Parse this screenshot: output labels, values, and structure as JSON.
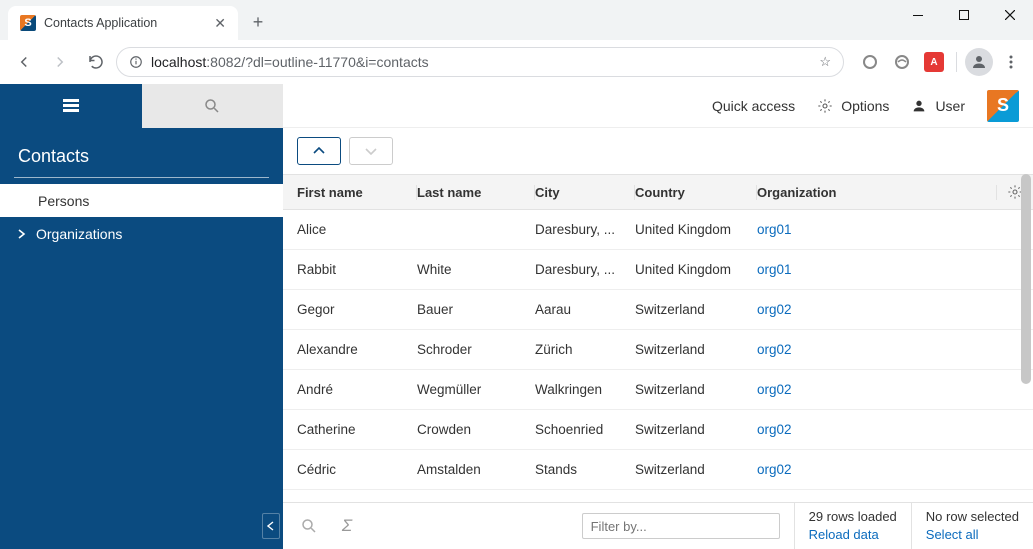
{
  "browser": {
    "tab_title": "Contacts Application",
    "url_host": "localhost",
    "url_port_path": ":8082/?dl=outline-11770&i=contacts"
  },
  "sidebar": {
    "heading": "Contacts",
    "items": [
      {
        "label": "Persons",
        "selected": true
      },
      {
        "label": "Organizations",
        "selected": false,
        "expandable": true
      }
    ]
  },
  "topbar": {
    "quick_access": "Quick access",
    "options": "Options",
    "user": "User"
  },
  "table": {
    "columns": [
      "First name",
      "Last name",
      "City",
      "Country",
      "Organization"
    ],
    "rows": [
      {
        "first": "Alice",
        "last": "",
        "city": "Daresbury, ...",
        "country": "United Kingdom",
        "org": "org01"
      },
      {
        "first": "Rabbit",
        "last": "White",
        "city": "Daresbury, ...",
        "country": "United Kingdom",
        "org": "org01"
      },
      {
        "first": "Gegor",
        "last": "Bauer",
        "city": "Aarau",
        "country": "Switzerland",
        "org": "org02"
      },
      {
        "first": "Alexandre",
        "last": "Schroder",
        "city": "Zürich",
        "country": "Switzerland",
        "org": "org02"
      },
      {
        "first": "André",
        "last": "Wegmüller",
        "city": "Walkringen",
        "country": "Switzerland",
        "org": "org02"
      },
      {
        "first": "Catherine",
        "last": "Crowden",
        "city": "Schoenried",
        "country": "Switzerland",
        "org": "org02"
      },
      {
        "first": "Cédric",
        "last": "Amstalden",
        "city": "Stands",
        "country": "Switzerland",
        "org": "org02"
      }
    ]
  },
  "footer": {
    "filter_placeholder": "Filter by...",
    "rows_loaded": "29 rows loaded",
    "reload": "Reload data",
    "no_row": "No row selected",
    "select_all": "Select all"
  }
}
